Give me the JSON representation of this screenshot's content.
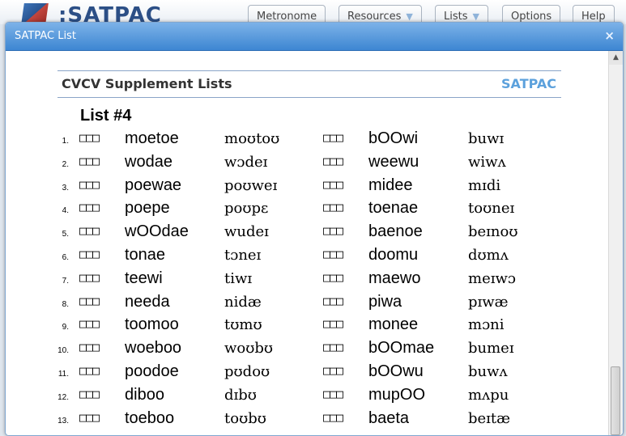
{
  "app": {
    "brand": ":SATPAC",
    "nav": [
      {
        "label": "Metronome",
        "dropdown": false
      },
      {
        "label": "Resources",
        "dropdown": true
      },
      {
        "label": "Lists",
        "dropdown": true
      },
      {
        "label": "Options",
        "dropdown": false
      },
      {
        "label": "Help",
        "dropdown": false
      }
    ]
  },
  "dialog": {
    "title": "SATPAC List",
    "close": "×"
  },
  "document": {
    "title": "CVCV Supplement Lists",
    "brand": "SATPAC",
    "list_title": "List #4",
    "checkbox_glyph": "□□□",
    "rows": [
      {
        "num": "1.",
        "w1": "moetoe",
        "i1": "moʊtoʊ",
        "w2": "bOOwi",
        "i2": "buwɪ"
      },
      {
        "num": "2.",
        "w1": "wodae",
        "i1": "wɔdeɪ",
        "w2": "weewu",
        "i2": "wiwʌ"
      },
      {
        "num": "3.",
        "w1": "poewae",
        "i1": "poʊweɪ",
        "w2": "midee",
        "i2": "mɪdi"
      },
      {
        "num": "4.",
        "w1": "poepe",
        "i1": "poʊpɛ",
        "w2": "toenae",
        "i2": "toʊneɪ"
      },
      {
        "num": "5.",
        "w1": "wOOdae",
        "i1": "wudeɪ",
        "w2": "baenoe",
        "i2": "beɪnoʊ"
      },
      {
        "num": "6.",
        "w1": "tonae",
        "i1": "tɔneɪ",
        "w2": "doomu",
        "i2": "dʊmʌ"
      },
      {
        "num": "7.",
        "w1": "teewi",
        "i1": "tiwɪ",
        "w2": "maewo",
        "i2": "meɪwɔ"
      },
      {
        "num": "8.",
        "w1": "needa",
        "i1": "nidæ",
        "w2": "piwa",
        "i2": "pɪwæ"
      },
      {
        "num": "9.",
        "w1": "toomoo",
        "i1": "tʊmʊ",
        "w2": "monee",
        "i2": "mɔni"
      },
      {
        "num": "10.",
        "w1": "woeboo",
        "i1": "woʊbʊ",
        "w2": "bOOmae",
        "i2": "bumeɪ"
      },
      {
        "num": "11.",
        "w1": "poodoe",
        "i1": "pʊdoʊ",
        "w2": "bOOwu",
        "i2": "buwʌ"
      },
      {
        "num": "12.",
        "w1": "diboo",
        "i1": "dɪbʊ",
        "w2": "mupOO",
        "i2": "mʌpu"
      },
      {
        "num": "13.",
        "w1": "toeboo",
        "i1": "toʊbʊ",
        "w2": "baeta",
        "i2": "beɪtæ"
      }
    ]
  },
  "colors": {
    "titlebar": "#3d86d2",
    "brand_accent": "#5ca1dc"
  }
}
